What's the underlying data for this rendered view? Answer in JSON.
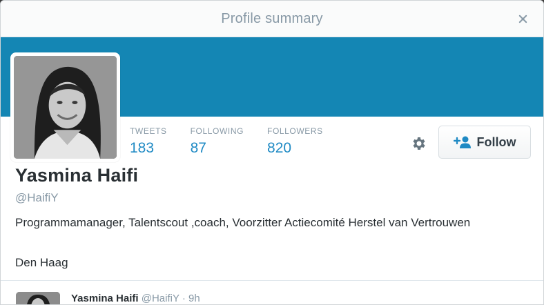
{
  "modal": {
    "title": "Profile summary"
  },
  "profile": {
    "name": "Yasmina Haifi",
    "screen_name": "@HaifiY",
    "bio": "Programmamanager, Talentscout ,coach, Voorzitter Actiecomité Herstel van Vertrouwen",
    "location": "Den Haag",
    "banner_color": "#1486b4"
  },
  "stats": [
    {
      "label": "TWEETS",
      "value": "183"
    },
    {
      "label": "FOLLOWING",
      "value": "87"
    },
    {
      "label": "FOLLOWERS",
      "value": "820"
    }
  ],
  "actions": {
    "follow_label": "Follow",
    "settings_icon": "gear-icon",
    "follow_icon": "add-user-icon"
  },
  "tweet_preview": {
    "name": "Yasmina Haifi",
    "handle": "@HaifiY",
    "separator": "·",
    "time": "9h"
  },
  "colors": {
    "accent": "#1f8ac4",
    "muted": "#8899a6",
    "text": "#292f33"
  }
}
